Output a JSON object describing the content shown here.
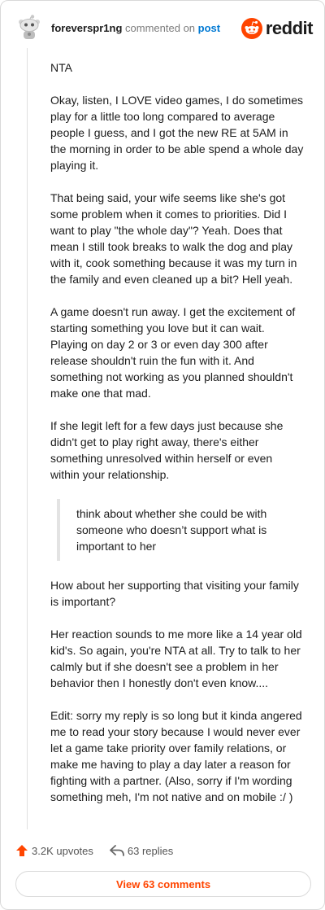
{
  "header": {
    "username": "foreverspr1ng",
    "action_text": "commented on",
    "post_link": "post",
    "brand": "reddit",
    "brand_color": "#ff4500",
    "link_color": "#0079d3"
  },
  "comment": {
    "paragraphs_before_quote": [
      "NTA",
      "Okay, listen, I LOVE video games, I do sometimes play for a little too long compared to average people I guess, and I got the new RE at 5AM in the morning in order to be able spend a whole day playing it.",
      "That being said, your wife seems like she's got some problem when it comes to priorities. Did I want to play \"the whole day\"? Yeah. Does that mean I still took breaks to walk the dog and play with it, cook something because it was my turn in the family and even cleaned up a bit? Hell yeah.",
      "A game doesn't run away. I get the excitement of starting something you love but it can wait. Playing on day 2 or 3 or even day 300 after release shouldn't ruin the fun with it. And something not working as you planned shouldn't make one that mad.",
      "If she legit left for a few days just because she didn't get to play right away, there's either something unresolved within herself or even within your relationship."
    ],
    "quote": "think about whether she could be with someone who doesn’t support what is important to her",
    "paragraphs_after_quote": [
      "How about her supporting that visiting your family is important?",
      "Her reaction sounds to me more like a 14 year old kid's. So again, you're NTA at all. Try to talk to her calmly but if she doesn't see a problem in her behavior then I honestly don't even know....",
      "Edit: sorry my reply is so long but it kinda angered me to read your story because I would never ever let a game take priority over family relations, or make me having to play a day later a reason for fighting with a partner. (Also, sorry if I'm wording something meh, I'm not native and on mobile :/ )"
    ]
  },
  "footer": {
    "upvotes": "3.2K upvotes",
    "replies": "63 replies",
    "view_comments": "View 63 comments",
    "upvote_icon": "upvote-arrow-icon",
    "reply_icon": "reply-arrow-icon"
  }
}
